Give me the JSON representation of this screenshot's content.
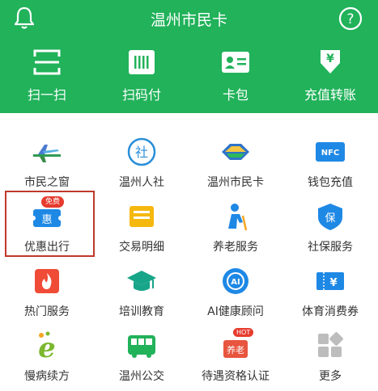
{
  "header": {
    "title": "温州市民卡",
    "quick_actions": [
      {
        "label": "扫一扫",
        "icon": "scan-icon"
      },
      {
        "label": "扫码付",
        "icon": "barcode-icon"
      },
      {
        "label": "卡包",
        "icon": "card-icon"
      },
      {
        "label": "充值转账",
        "icon": "recharge-icon"
      }
    ]
  },
  "grid": {
    "items": [
      {
        "label": "市民之窗",
        "icon": "airplane-icon"
      },
      {
        "label": "温州人社",
        "icon": "social-icon"
      },
      {
        "label": "温州市民卡",
        "icon": "citizen-card-icon"
      },
      {
        "label": "钱包充值",
        "icon": "nfc-icon"
      },
      {
        "label": "优惠出行",
        "icon": "discount-icon",
        "badge": "免费"
      },
      {
        "label": "交易明细",
        "icon": "transaction-icon"
      },
      {
        "label": "养老服务",
        "icon": "elderly-icon"
      },
      {
        "label": "社保服务",
        "icon": "insurance-icon"
      },
      {
        "label": "热门服务",
        "icon": "fire-icon"
      },
      {
        "label": "培训教育",
        "icon": "graduation-icon"
      },
      {
        "label": "AI健康顾问",
        "icon": "ai-icon"
      },
      {
        "label": "体育消费券",
        "icon": "coupon-icon"
      },
      {
        "label": "慢病续方",
        "icon": "prescription-icon"
      },
      {
        "label": "温州公交",
        "icon": "bus-icon"
      },
      {
        "label": "待遇资格认证",
        "icon": "certification-icon",
        "badge": "HOT"
      },
      {
        "label": "更多",
        "icon": "more-icon"
      }
    ]
  },
  "colors": {
    "brand": "#21b25a",
    "highlight": "#c0392b",
    "badge": "#e63b2e"
  }
}
